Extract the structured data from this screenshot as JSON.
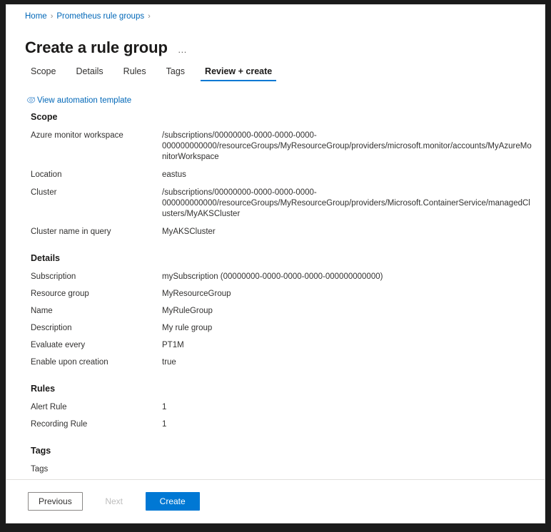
{
  "breadcrumb": {
    "items": [
      {
        "label": "Home"
      },
      {
        "label": "Prometheus rule groups"
      }
    ],
    "separator": "›"
  },
  "header": {
    "title": "Create a rule group",
    "more_menu": "…"
  },
  "tabs": [
    {
      "label": "Scope",
      "active": false
    },
    {
      "label": "Details",
      "active": false
    },
    {
      "label": "Rules",
      "active": false
    },
    {
      "label": "Tags",
      "active": false
    },
    {
      "label": "Review + create",
      "active": true
    }
  ],
  "automation": {
    "label": "View automation template",
    "icon": "view-template-icon"
  },
  "sections": [
    {
      "title": "Scope",
      "rows": [
        {
          "key": "Azure monitor workspace",
          "value": "/subscriptions/00000000-0000-0000-0000-\n000000000000/resourceGroups/MyResourceGroup/providers/microsoft.monitor/accounts/MyAzureMonitorWorkspace"
        },
        {
          "key": "Location",
          "value": "eastus"
        },
        {
          "key": "Cluster",
          "value": "/subscriptions/00000000-0000-0000-0000-\n000000000000/resourceGroups/MyResourceGroup/providers/Microsoft.ContainerService/managedClusters/MyAKSCluster"
        },
        {
          "key": "Cluster name in query",
          "value": "MyAKSCluster"
        }
      ]
    },
    {
      "title": "Details",
      "rows": [
        {
          "key": "Subscription",
          "value": "mySubscription (00000000-0000-0000-0000-000000000000)"
        },
        {
          "key": "Resource group",
          "value": "MyResourceGroup"
        },
        {
          "key": "Name",
          "value": "MyRuleGroup"
        },
        {
          "key": "Description",
          "value": "My rule group"
        },
        {
          "key": "Evaluate every",
          "value": "PT1M"
        },
        {
          "key": "Enable upon creation",
          "value": "true"
        }
      ]
    },
    {
      "title": "Rules",
      "rows": [
        {
          "key": "Alert Rule",
          "value": "1"
        },
        {
          "key": "Recording Rule",
          "value": "1"
        }
      ]
    },
    {
      "title": "Tags",
      "rows": [
        {
          "key": "Tags",
          "value": ""
        }
      ]
    }
  ],
  "footer": {
    "previous_label": "Previous",
    "next_label": "Next",
    "create_label": "Create"
  },
  "colors": {
    "accent": "#0078d4",
    "link": "#0067b8",
    "text": "#323130",
    "heading": "#1b1a19",
    "divider": "#e1dfdd"
  }
}
